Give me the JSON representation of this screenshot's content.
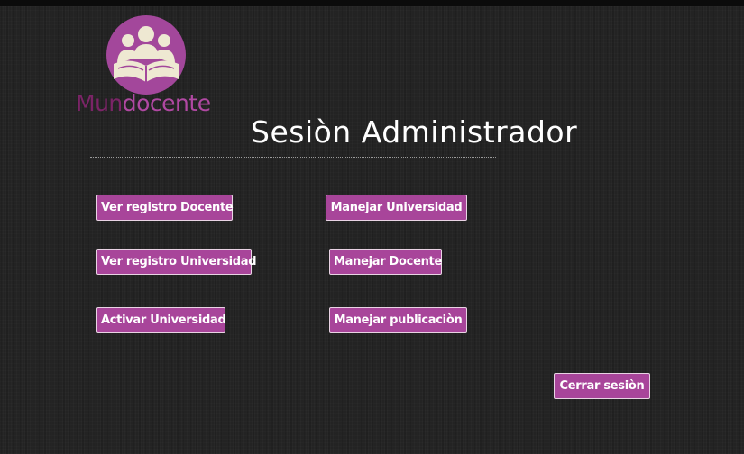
{
  "brand": {
    "logo_text_part1": "Mun",
    "logo_text_part2": "docente",
    "colors": {
      "logo_circle": "#a3479b",
      "logo_figures": "#eee8d2",
      "logo_text_dark": "#7b2467",
      "logo_text_light": "#b048a2"
    },
    "icon": "people-reading-book-logo-icon"
  },
  "header": {
    "title": "Sesiòn Administrador"
  },
  "actions": {
    "ver_registro_docente": "Ver registro Docente",
    "manejar_universidad": "Manejar Universidad",
    "ver_registro_universidad": "Ver registro Universidad",
    "manejar_docente": "Manejar Docente",
    "activar_universidad": "Activar Universidad",
    "manejar_publicacion": "Manejar publicaciòn"
  },
  "session": {
    "logout_label": "Cerrar sesiòn"
  },
  "theme": {
    "button_bg": "#a8459a",
    "button_border": "#e9d3e4",
    "background": "#232323",
    "text": "#ffffff"
  }
}
